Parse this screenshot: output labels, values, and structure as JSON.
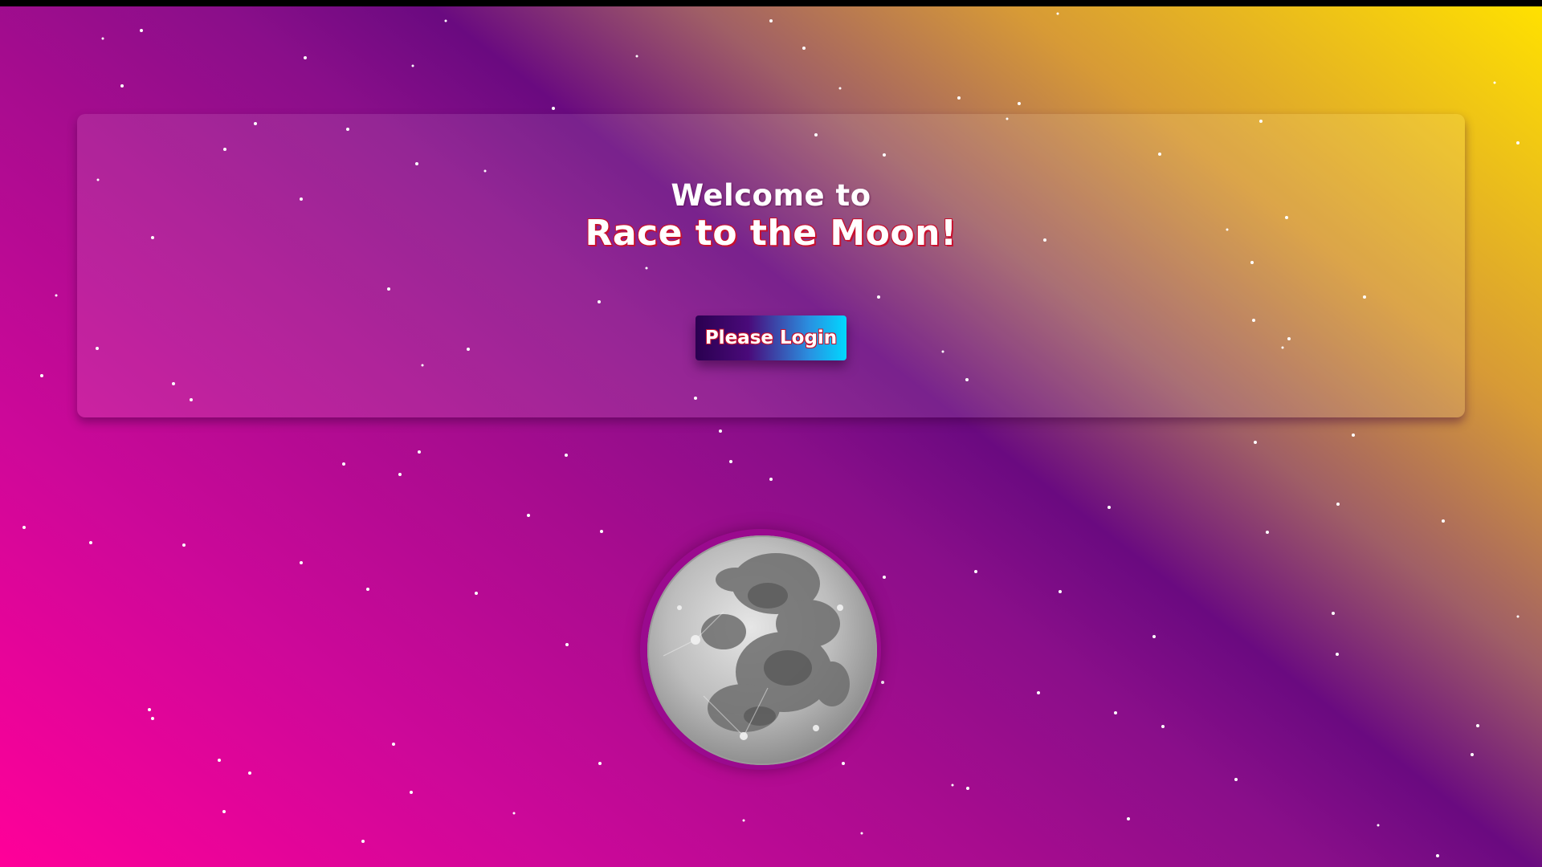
{
  "header": {
    "welcome_text": "Welcome to",
    "title": "Race to the Moon!"
  },
  "actions": {
    "login_label": "Please Login"
  },
  "illustration": {
    "icon": "moon-icon"
  },
  "colors": {
    "title_outline": "#c8102e",
    "button_gradient_start": "#2a0050",
    "button_gradient_end": "#00d8ff",
    "background_pink": "#ff0099",
    "background_purple": "#6a0a80",
    "background_yellow": "#ffe100"
  }
}
